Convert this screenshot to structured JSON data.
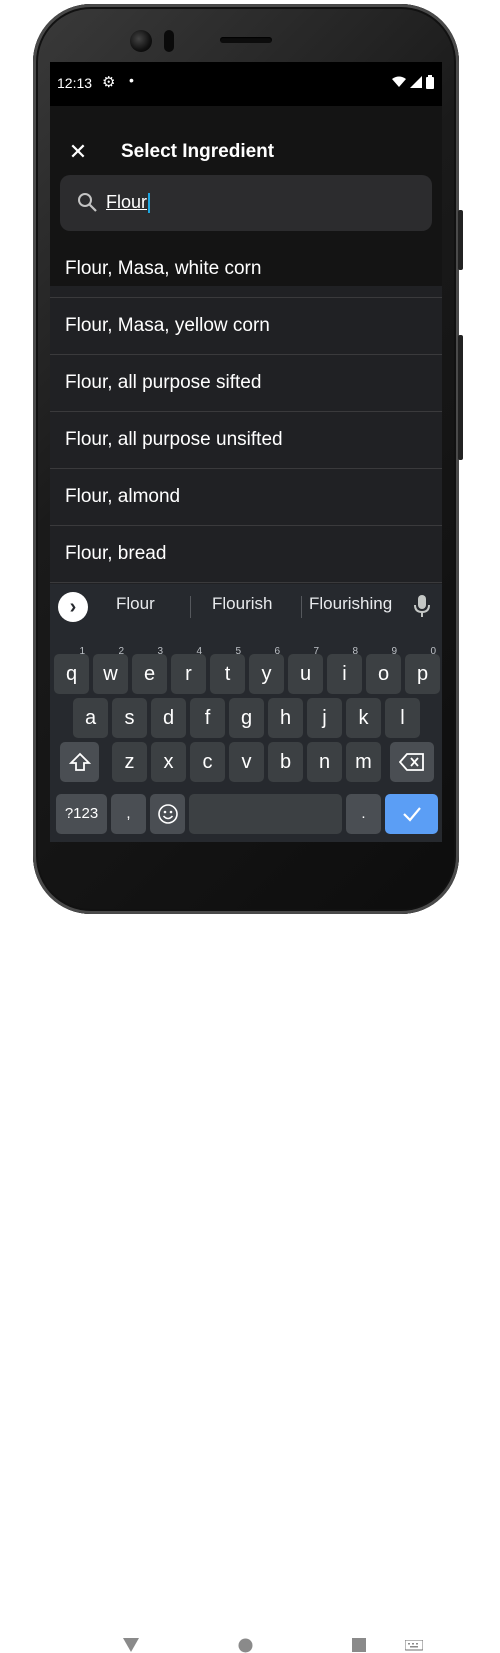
{
  "status_bar": {
    "time": "12:13",
    "settings_icon": "gear-icon",
    "dot": "•"
  },
  "app_bar": {
    "close_icon": "close-icon",
    "title": "Select Ingredient"
  },
  "search": {
    "value": "Flour",
    "icon": "search-icon"
  },
  "results": [
    "Flour, Masa, white corn",
    "Flour, Masa, yellow corn",
    "Flour, all purpose sifted",
    "Flour, all purpose unsifted",
    "Flour, almond",
    "Flour, bread"
  ],
  "keyboard": {
    "suggestions": [
      "Flour",
      "Flourish",
      "Flourishing"
    ],
    "row1": [
      {
        "k": "q",
        "h": "1"
      },
      {
        "k": "w",
        "h": "2"
      },
      {
        "k": "e",
        "h": "3"
      },
      {
        "k": "r",
        "h": "4"
      },
      {
        "k": "t",
        "h": "5"
      },
      {
        "k": "y",
        "h": "6"
      },
      {
        "k": "u",
        "h": "7"
      },
      {
        "k": "i",
        "h": "8"
      },
      {
        "k": "o",
        "h": "9"
      },
      {
        "k": "p",
        "h": "0"
      }
    ],
    "row2": [
      "a",
      "s",
      "d",
      "f",
      "g",
      "h",
      "j",
      "k",
      "l"
    ],
    "row3": [
      "z",
      "x",
      "c",
      "v",
      "b",
      "n",
      "m"
    ],
    "symbols_label": "?123",
    "comma": ",",
    "period": ".",
    "emoji_icon": "emoji-icon",
    "shift_icon": "shift-icon",
    "backspace_icon": "backspace-icon",
    "enter_icon": "check-icon"
  },
  "colors": {
    "screen_bg": "#202124",
    "keyboard_bg": "#26292e",
    "enter_key": "#5b9ef5",
    "caret": "#1ea7e1"
  }
}
